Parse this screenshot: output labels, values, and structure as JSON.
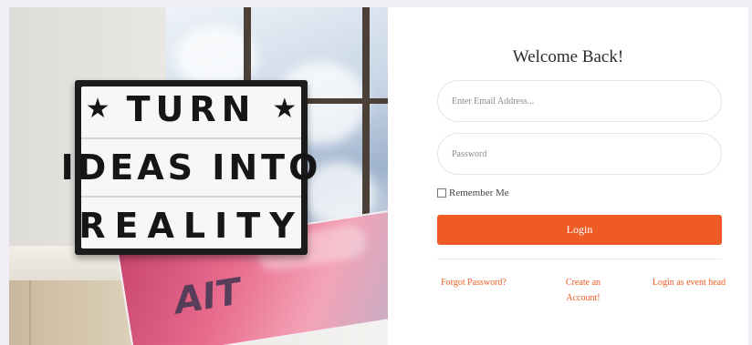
{
  "hero": {
    "sign_line1": "TURN",
    "sign_star": "★",
    "sign_line2": "IDEAS INTO",
    "sign_line3": "REALITY",
    "magazine_text": "AIT"
  },
  "form": {
    "title": "Welcome Back!",
    "email_placeholder": "Enter Email Address...",
    "password_placeholder": "Password",
    "remember_label": "Remember Me",
    "login_label": "Login",
    "links": [
      "Forgot Password?",
      "Create an Account!",
      "Login as event head"
    ]
  },
  "colors": {
    "accent": "#ef5b24",
    "background": "#f1eef5"
  }
}
